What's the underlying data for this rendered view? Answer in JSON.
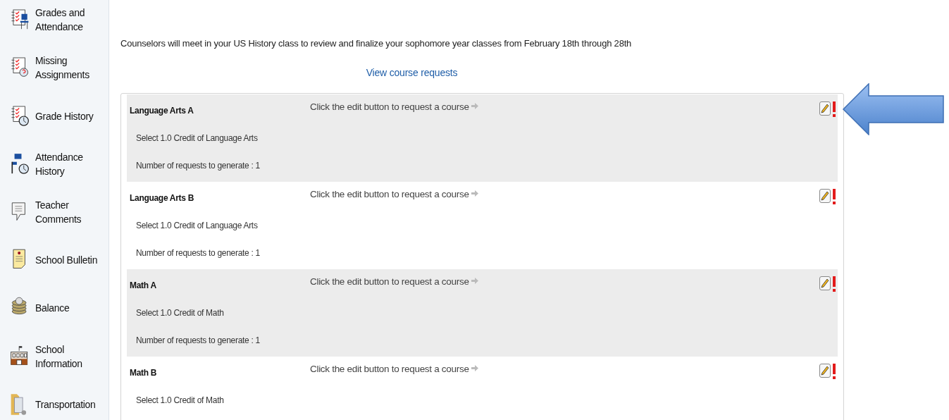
{
  "sidebar": {
    "items": [
      {
        "label": [
          "Grades and",
          "Attendance"
        ]
      },
      {
        "label": [
          "Missing",
          "Assignments"
        ]
      },
      {
        "label": [
          "Grade History"
        ]
      },
      {
        "label": [
          "Attendance",
          "History"
        ]
      },
      {
        "label": [
          "Teacher",
          "Comments"
        ]
      },
      {
        "label": [
          "School Bulletin"
        ]
      },
      {
        "label": [
          "Balance"
        ]
      },
      {
        "label": [
          "School",
          "Information"
        ]
      },
      {
        "label": [
          "Transportation"
        ]
      }
    ]
  },
  "notice": "Counselors will meet in your US History class to review and finalize your sophomore year classes from February 18th through 28th",
  "link": "View course requests",
  "requests": [
    {
      "course": "Language Arts A",
      "details": [
        "Select 1.0 Credit of Language Arts",
        "Number of requests to generate : 1"
      ],
      "instruction": "Click the edit button to request a course"
    },
    {
      "course": "Language Arts B",
      "details": [
        "Select 1.0 Credit of Language Arts",
        "Number of requests to generate : 1"
      ],
      "instruction": "Click the edit button to request a course"
    },
    {
      "course": "Math A",
      "details": [
        "Select 1.0 Credit of Math",
        "Number of requests to generate : 1"
      ],
      "instruction": "Click the edit button to request a course"
    },
    {
      "course": "Math B",
      "details": [
        "Select 1.0 Credit of Math"
      ],
      "instruction": "Click the edit button to request a course"
    }
  ]
}
